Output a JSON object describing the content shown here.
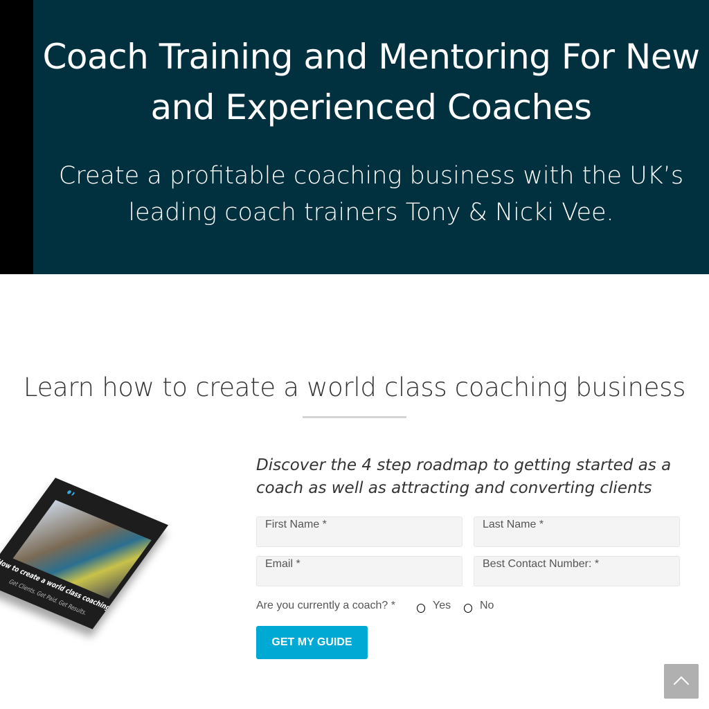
{
  "hero": {
    "title": "Coach Training and Mentoring For New and Experienced Coaches",
    "subtitle": "Create a profitable coaching business with the UK’s leading coach trainers Tony & Nicki Vee."
  },
  "section": {
    "title": "Learn how to create a world class coaching business",
    "intro": "Discover the 4 step roadmap to getting started as a coach as well as attracting and converting clients"
  },
  "book": {
    "cover_title": "How to create a world class coaching business",
    "cover_tagline": "Get Clients. Get Paid. Get Results."
  },
  "form": {
    "first_name": "First Name *",
    "last_name": "Last Name *",
    "email": "Email *",
    "phone": "Best Contact Number: *",
    "question": "Are you currently a coach? *",
    "options": [
      "Yes",
      "No"
    ],
    "submit": "GET MY GUIDE"
  },
  "colors": {
    "hero_bg": "#01313e",
    "button": "#00a9d4"
  },
  "icons": {
    "back_to_top": "chevron-up-icon"
  }
}
